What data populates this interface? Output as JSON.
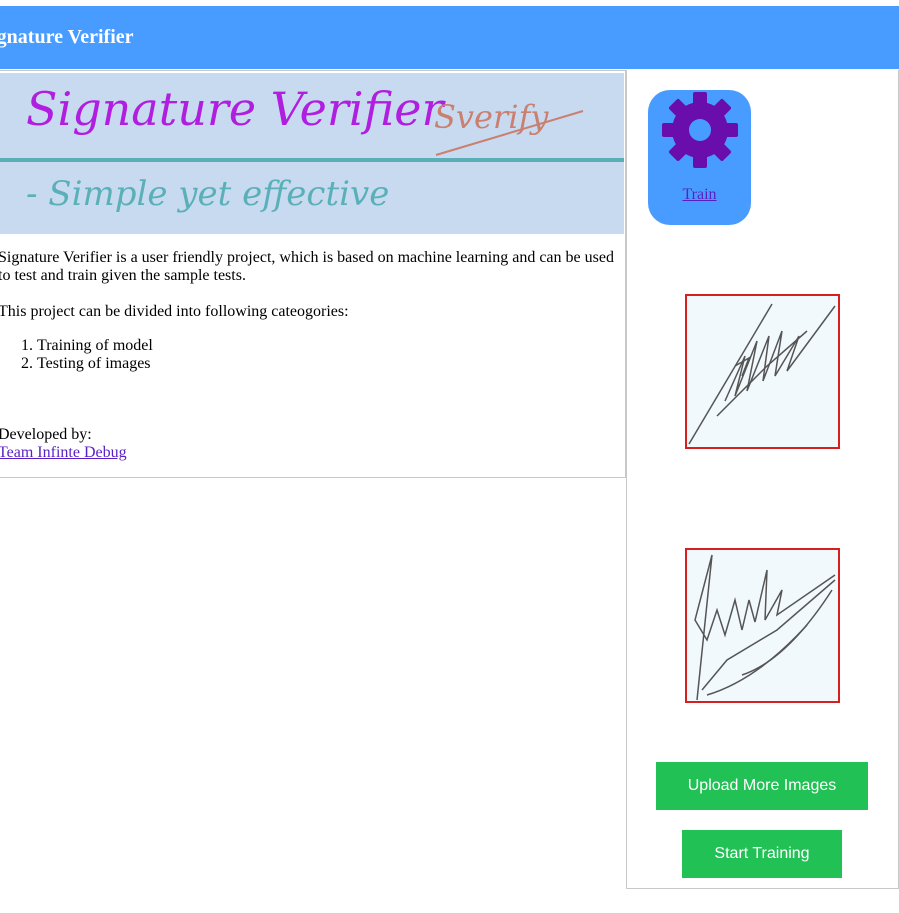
{
  "header": {
    "title": "Signature Verifier"
  },
  "banner": {
    "heading": "Signature Verifier",
    "tagline": "- Simple yet effective",
    "logo": "Sverify"
  },
  "description": {
    "intro": "Signature Verifier is a user friendly project, which is based on machine learning and can be used to test and train given the sample tests.",
    "categories_intro": "This project can be divided into following cateogories:",
    "categories": [
      "Training of model",
      "Testing of images"
    ]
  },
  "developer": {
    "label": "Developed by:",
    "team": "Team Infinte Debug"
  },
  "sidebar": {
    "train_label": "Train",
    "upload_label": "Upload More Images",
    "start_label": "Start Training"
  },
  "colors": {
    "header": "#499cff",
    "gear": "#6a0dad",
    "button": "#22c155",
    "signature_border": "#d62020"
  }
}
